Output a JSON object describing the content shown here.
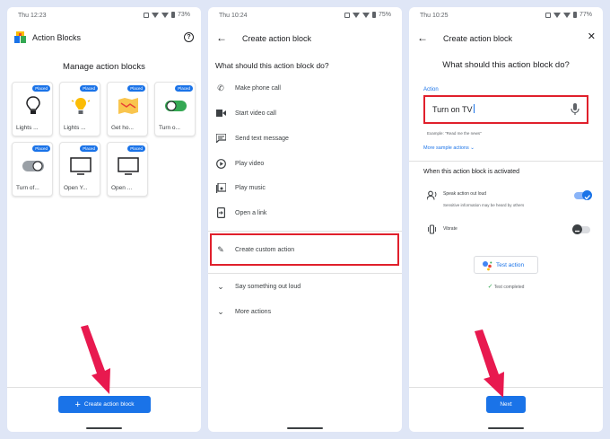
{
  "phone1": {
    "status_time": "Thu 12:23",
    "battery": "73%",
    "title": "Action Blocks",
    "heading": "Manage action blocks",
    "tiles": [
      {
        "label": "Lights ...",
        "badge": "Placed",
        "icon": "light-bulb-off-icon"
      },
      {
        "label": "Lights ...",
        "badge": "Placed",
        "icon": "light-bulb-on-icon"
      },
      {
        "label": "Get ho...",
        "badge": "Placed",
        "icon": "map-icon"
      },
      {
        "label": "Turn o...",
        "badge": "Placed",
        "icon": "toggle-on-icon"
      },
      {
        "label": "Turn of...",
        "badge": "Placed",
        "icon": "toggle-off-icon"
      },
      {
        "label": "Open Y...",
        "badge": "Placed",
        "icon": "tv-icon"
      },
      {
        "label": "Open ...",
        "badge": "Placed",
        "icon": "tv-icon"
      }
    ],
    "create_button": "Create action block"
  },
  "phone2": {
    "status_time": "Thu 10:24",
    "battery": "75%",
    "title": "Create action block",
    "question": "What should this action block do?",
    "options": [
      {
        "label": "Make phone call",
        "icon": "phone-icon"
      },
      {
        "label": "Start video call",
        "icon": "video-icon"
      },
      {
        "label": "Send text message",
        "icon": "message-icon"
      },
      {
        "label": "Play video",
        "icon": "play-icon"
      },
      {
        "label": "Play music",
        "icon": "music-icon"
      },
      {
        "label": "Open a link",
        "icon": "link-icon"
      }
    ],
    "custom_action": "Create custom action",
    "say_out_loud": "Say something out loud",
    "more_actions": "More actions"
  },
  "phone3": {
    "status_time": "Thu 10:25",
    "battery": "77%",
    "title": "Create action block",
    "question": "What should this action block do?",
    "action_label": "Action",
    "action_value": "Turn on TV",
    "example_hint": "Example: \"Read me the news\"",
    "more_samples": "More sample actions",
    "activated_title": "When this action block is activated",
    "speak_label": "Speak action out loud",
    "speak_sub": "Sensitive information may be heard by others",
    "speak_on": true,
    "vibrate_label": "Vibrate",
    "vibrate_on": false,
    "test_button": "Test action",
    "test_status": "Test completed",
    "next_button": "Next"
  },
  "colors": {
    "accent": "#1a73e8",
    "highlight": "#e0202c",
    "arrow": "#e8194f",
    "background": "#dfe6f6"
  }
}
